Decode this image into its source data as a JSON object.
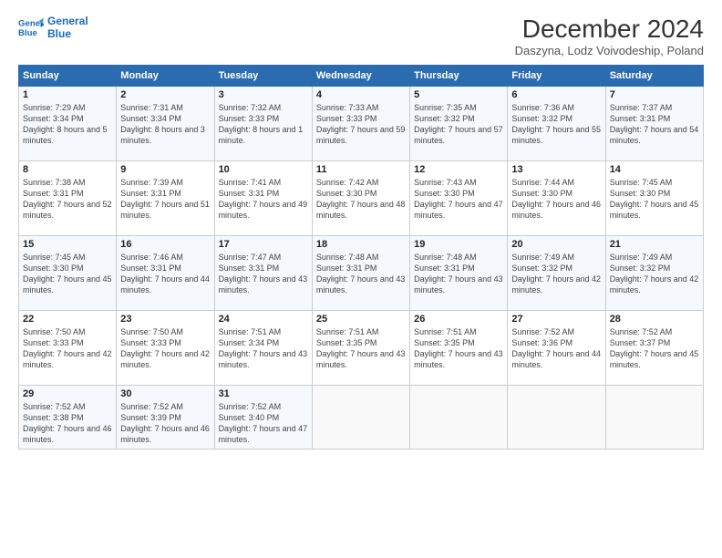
{
  "header": {
    "logo_line1": "General",
    "logo_line2": "Blue",
    "title": "December 2024",
    "subtitle": "Daszyna, Lodz Voivodeship, Poland"
  },
  "days_of_week": [
    "Sunday",
    "Monday",
    "Tuesday",
    "Wednesday",
    "Thursday",
    "Friday",
    "Saturday"
  ],
  "weeks": [
    [
      {
        "day": "1",
        "info": "Sunrise: 7:29 AM\nSunset: 3:34 PM\nDaylight: 8 hours and 5 minutes."
      },
      {
        "day": "2",
        "info": "Sunrise: 7:31 AM\nSunset: 3:34 PM\nDaylight: 8 hours and 3 minutes."
      },
      {
        "day": "3",
        "info": "Sunrise: 7:32 AM\nSunset: 3:33 PM\nDaylight: 8 hours and 1 minute."
      },
      {
        "day": "4",
        "info": "Sunrise: 7:33 AM\nSunset: 3:33 PM\nDaylight: 7 hours and 59 minutes."
      },
      {
        "day": "5",
        "info": "Sunrise: 7:35 AM\nSunset: 3:32 PM\nDaylight: 7 hours and 57 minutes."
      },
      {
        "day": "6",
        "info": "Sunrise: 7:36 AM\nSunset: 3:32 PM\nDaylight: 7 hours and 55 minutes."
      },
      {
        "day": "7",
        "info": "Sunrise: 7:37 AM\nSunset: 3:31 PM\nDaylight: 7 hours and 54 minutes."
      }
    ],
    [
      {
        "day": "8",
        "info": "Sunrise: 7:38 AM\nSunset: 3:31 PM\nDaylight: 7 hours and 52 minutes."
      },
      {
        "day": "9",
        "info": "Sunrise: 7:39 AM\nSunset: 3:31 PM\nDaylight: 7 hours and 51 minutes."
      },
      {
        "day": "10",
        "info": "Sunrise: 7:41 AM\nSunset: 3:31 PM\nDaylight: 7 hours and 49 minutes."
      },
      {
        "day": "11",
        "info": "Sunrise: 7:42 AM\nSunset: 3:30 PM\nDaylight: 7 hours and 48 minutes."
      },
      {
        "day": "12",
        "info": "Sunrise: 7:43 AM\nSunset: 3:30 PM\nDaylight: 7 hours and 47 minutes."
      },
      {
        "day": "13",
        "info": "Sunrise: 7:44 AM\nSunset: 3:30 PM\nDaylight: 7 hours and 46 minutes."
      },
      {
        "day": "14",
        "info": "Sunrise: 7:45 AM\nSunset: 3:30 PM\nDaylight: 7 hours and 45 minutes."
      }
    ],
    [
      {
        "day": "15",
        "info": "Sunrise: 7:45 AM\nSunset: 3:30 PM\nDaylight: 7 hours and 45 minutes."
      },
      {
        "day": "16",
        "info": "Sunrise: 7:46 AM\nSunset: 3:31 PM\nDaylight: 7 hours and 44 minutes."
      },
      {
        "day": "17",
        "info": "Sunrise: 7:47 AM\nSunset: 3:31 PM\nDaylight: 7 hours and 43 minutes."
      },
      {
        "day": "18",
        "info": "Sunrise: 7:48 AM\nSunset: 3:31 PM\nDaylight: 7 hours and 43 minutes."
      },
      {
        "day": "19",
        "info": "Sunrise: 7:48 AM\nSunset: 3:31 PM\nDaylight: 7 hours and 43 minutes."
      },
      {
        "day": "20",
        "info": "Sunrise: 7:49 AM\nSunset: 3:32 PM\nDaylight: 7 hours and 42 minutes."
      },
      {
        "day": "21",
        "info": "Sunrise: 7:49 AM\nSunset: 3:32 PM\nDaylight: 7 hours and 42 minutes."
      }
    ],
    [
      {
        "day": "22",
        "info": "Sunrise: 7:50 AM\nSunset: 3:33 PM\nDaylight: 7 hours and 42 minutes."
      },
      {
        "day": "23",
        "info": "Sunrise: 7:50 AM\nSunset: 3:33 PM\nDaylight: 7 hours and 42 minutes."
      },
      {
        "day": "24",
        "info": "Sunrise: 7:51 AM\nSunset: 3:34 PM\nDaylight: 7 hours and 43 minutes."
      },
      {
        "day": "25",
        "info": "Sunrise: 7:51 AM\nSunset: 3:35 PM\nDaylight: 7 hours and 43 minutes."
      },
      {
        "day": "26",
        "info": "Sunrise: 7:51 AM\nSunset: 3:35 PM\nDaylight: 7 hours and 43 minutes."
      },
      {
        "day": "27",
        "info": "Sunrise: 7:52 AM\nSunset: 3:36 PM\nDaylight: 7 hours and 44 minutes."
      },
      {
        "day": "28",
        "info": "Sunrise: 7:52 AM\nSunset: 3:37 PM\nDaylight: 7 hours and 45 minutes."
      }
    ],
    [
      {
        "day": "29",
        "info": "Sunrise: 7:52 AM\nSunset: 3:38 PM\nDaylight: 7 hours and 46 minutes."
      },
      {
        "day": "30",
        "info": "Sunrise: 7:52 AM\nSunset: 3:39 PM\nDaylight: 7 hours and 46 minutes."
      },
      {
        "day": "31",
        "info": "Sunrise: 7:52 AM\nSunset: 3:40 PM\nDaylight: 7 hours and 47 minutes."
      },
      {
        "day": "",
        "info": ""
      },
      {
        "day": "",
        "info": ""
      },
      {
        "day": "",
        "info": ""
      },
      {
        "day": "",
        "info": ""
      }
    ]
  ]
}
